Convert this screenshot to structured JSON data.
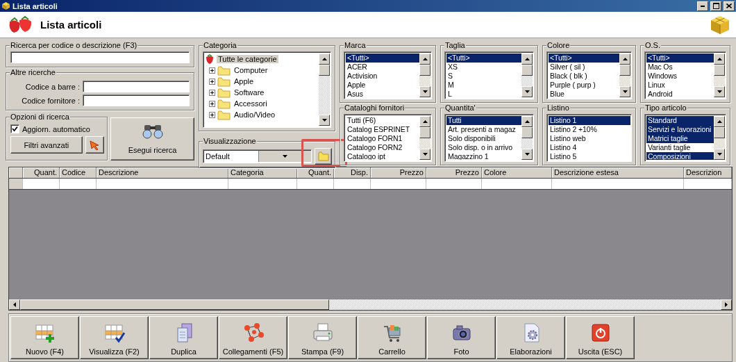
{
  "window": {
    "title": "Lista articoli"
  },
  "header": {
    "title": "Lista articoli"
  },
  "search": {
    "label": "Ricerca per codice o descrizione (F3)"
  },
  "other_searches": {
    "label": "Altre ricerche",
    "fields": [
      {
        "label": "Codice a barre :"
      },
      {
        "label": "Codice fornitore :"
      }
    ]
  },
  "options": {
    "label": "Opzioni di ricerca",
    "checkbox": {
      "label": "Aggiorn. automatico",
      "checked": true
    },
    "advanced_button": "Filtri avanzati",
    "run_button": "Esegui ricerca"
  },
  "category": {
    "label": "Categoria",
    "tree": [
      {
        "label": "Tutte le categorie",
        "selected": true,
        "children": [
          {
            "label": "Computer",
            "selected": false,
            "expanded": false
          },
          {
            "label": "Apple",
            "selected": false,
            "expanded": false
          },
          {
            "label": "Software",
            "selected": false,
            "expanded": false
          },
          {
            "label": "Accessori",
            "selected": false,
            "expanded": false
          },
          {
            "label": "Audio/Video",
            "selected": false,
            "expanded": false
          }
        ]
      }
    ]
  },
  "visualization": {
    "label": "Visualizzazione",
    "value": "Default"
  },
  "filters": [
    {
      "label": "Marca",
      "items": [
        {
          "text": "<Tutti>",
          "selected": true
        },
        {
          "text": "ACER",
          "selected": false
        },
        {
          "text": "Activision",
          "selected": false
        },
        {
          "text": "Apple",
          "selected": false
        },
        {
          "text": "Asus",
          "selected": false
        }
      ]
    },
    {
      "label": "Taglia",
      "items": [
        {
          "text": "<Tutti>",
          "selected": true
        },
        {
          "text": "XS",
          "selected": false
        },
        {
          "text": "S",
          "selected": false
        },
        {
          "text": "M",
          "selected": false
        },
        {
          "text": "L",
          "selected": false
        }
      ]
    },
    {
      "label": "Colore",
      "items": [
        {
          "text": "<Tutti>",
          "selected": true
        },
        {
          "text": "Silver ( sil )",
          "selected": false
        },
        {
          "text": "Black ( blk )",
          "selected": false
        },
        {
          "text": "Purple ( purp )",
          "selected": false
        },
        {
          "text": "Blue",
          "selected": false
        }
      ]
    },
    {
      "label": "O.S.",
      "items": [
        {
          "text": "<Tutti>",
          "selected": true
        },
        {
          "text": "Mac Os",
          "selected": false
        },
        {
          "text": "Windows",
          "selected": false
        },
        {
          "text": "Linux",
          "selected": false
        },
        {
          "text": "Android",
          "selected": false
        }
      ]
    },
    {
      "label": "Cataloghi fornitori",
      "items": [
        {
          "text": "Tutti (F6)",
          "selected": false
        },
        {
          "text": "Catalog ESPRINET",
          "selected": false
        },
        {
          "text": "Catalogo FORN1",
          "selected": false
        },
        {
          "text": "Catalogo FORN2",
          "selected": false
        },
        {
          "text": "Catalogo ipt",
          "selected": false
        }
      ]
    },
    {
      "label": "Quantita'",
      "items": [
        {
          "text": "Tutti",
          "selected": true
        },
        {
          "text": "Art. presenti a magaz",
          "selected": false
        },
        {
          "text": "Solo disponibili",
          "selected": false
        },
        {
          "text": "Solo disp. o in arrivo",
          "selected": false
        },
        {
          "text": "Magazzino 1",
          "selected": false
        }
      ]
    },
    {
      "label": "Listino",
      "items": [
        {
          "text": "Listino 1",
          "selected": true
        },
        {
          "text": "Listino 2 +10%",
          "selected": false
        },
        {
          "text": "Listino web",
          "selected": false
        },
        {
          "text": "Listino 4",
          "selected": false
        },
        {
          "text": "Listino 5",
          "selected": false
        }
      ]
    },
    {
      "label": "Tipo articolo",
      "items": [
        {
          "text": "Standard",
          "selected": true
        },
        {
          "text": "Servizi e lavorazioni",
          "selected": true
        },
        {
          "text": "Matrici taglie",
          "selected": true
        },
        {
          "text": "Varianti taglie",
          "selected": false
        },
        {
          "text": "Composizioni",
          "selected": true
        }
      ]
    }
  ],
  "table": {
    "columns": [
      "Quant.",
      "Codice",
      "Descrizione",
      "Categoria",
      "Quant.",
      "Disp.",
      "Prezzo",
      "Prezzo",
      "Colore",
      "Descrizione estesa",
      "Descrizion"
    ]
  },
  "toolbar": [
    "Nuovo (F4)",
    "Visualizza (F2)",
    "Duplica",
    "Collegamenti (F5)",
    "Stampa (F9)",
    "Carrello",
    "Foto",
    "Elaborazioni",
    "Uscita (ESC)"
  ]
}
